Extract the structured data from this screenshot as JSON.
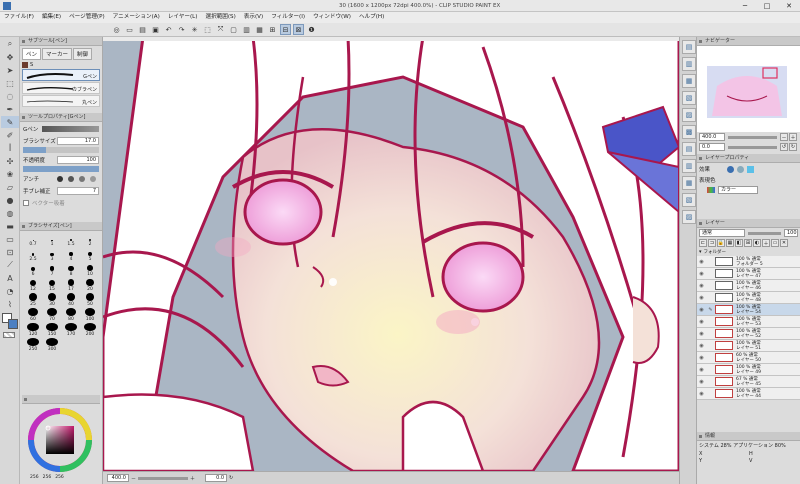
{
  "title": "30 (1600 x 1200px 72dpi 400.0%) - CLIP STUDIO PAINT EX",
  "menu": [
    "ファイル(F)",
    "編集(E)",
    "ページ管理(P)",
    "アニメーション(A)",
    "レイヤー(L)",
    "選択範囲(S)",
    "表示(V)",
    "フィルター(I)",
    "ウィンドウ(W)",
    "ヘルプ(H)"
  ],
  "left": {
    "subtool_header": "サブツール[ペン]",
    "tabs": [
      "ペン",
      "マーカー",
      "制御"
    ],
    "current_subtool": "S",
    "brushes": [
      {
        "label": "Gペン",
        "selected": true
      },
      {
        "label": "カブラペン",
        "selected": false
      },
      {
        "label": "丸ペン",
        "selected": false
      }
    ],
    "toolprop_header": "ツールプロパティ[Gペン]",
    "toolprop_name": "Gペン",
    "brush_size_label": "ブラシサイズ",
    "brush_size_value": "17.0",
    "opacity_label": "不透明度",
    "opacity_value": "100",
    "antialias_label": "アンチ",
    "stabilize_label": "手ブレ補正",
    "stabilize_value": "7",
    "vector_label": "ベクター吸着",
    "size_header": "ブラシサイズ[ペン]",
    "sizes": [
      "0.7",
      "1",
      "1.5",
      "2",
      "2.5",
      "3",
      "4",
      "5",
      "6",
      "7",
      "8",
      "10",
      "12",
      "15",
      "17",
      "20",
      "25",
      "30",
      "40",
      "50",
      "60",
      "70",
      "80",
      "100",
      "120",
      "150",
      "170",
      "200",
      "250",
      "300"
    ],
    "color_values": [
      "256",
      "256",
      "256"
    ]
  },
  "tools": [
    "zoom-icon",
    "move-icon",
    "operation-icon",
    "select-icon",
    "lasso-icon",
    "eyedropper-icon",
    "pen-icon",
    "pencil-icon",
    "brush-icon",
    "airbrush-icon",
    "deco-icon",
    "eraser-icon",
    "blend-icon",
    "fill-icon",
    "gradient-icon",
    "figure-icon",
    "frame-icon",
    "ruler-icon",
    "text-icon",
    "balloon-icon",
    "line-fix-icon"
  ],
  "status": {
    "zoom": "400.0",
    "angle": "0.0"
  },
  "right": {
    "navigator_header": "ナビゲーター",
    "nav_zoom": "400.0",
    "nav_angle": "0.0",
    "layerprop_header": "レイヤープロパティ",
    "effect_label": "効果",
    "expression_label": "表現色",
    "expression_value": "カラー",
    "layer_header": "レイヤー",
    "blend_mode": "通常",
    "opacity": "100",
    "folder_label": "フォルダー",
    "layers": [
      {
        "line1": "100 % 通常",
        "line2": "フォルダー 5",
        "selected": false,
        "folder": true
      },
      {
        "line1": "100 % 通常",
        "line2": "レイヤー 47",
        "selected": false
      },
      {
        "line1": "100 % 通常",
        "line2": "レイヤー 46",
        "selected": false
      },
      {
        "line1": "100 % 通常",
        "line2": "レイヤー 48",
        "selected": false
      },
      {
        "line1": "100 % 通常",
        "line2": "レイヤー 54",
        "selected": true
      },
      {
        "line1": "100 % 通常",
        "line2": "レイヤー 53",
        "selected": false
      },
      {
        "line1": "100 % 通常",
        "line2": "レイヤー 52",
        "selected": false
      },
      {
        "line1": "100 % 通常",
        "line2": "レイヤー 51",
        "selected": false
      },
      {
        "line1": "60 % 通常",
        "line2": "レイヤー 50",
        "selected": false
      },
      {
        "line1": "100 % 通常",
        "line2": "レイヤー 49",
        "selected": false
      },
      {
        "line1": "67 % 通常",
        "line2": "レイヤー 45",
        "selected": false
      },
      {
        "line1": "100 % 通常",
        "line2": "レイヤー 44",
        "selected": false
      }
    ],
    "info_header": "情報",
    "system_line": "システム 28%  アプリケーション 80%",
    "coord_labels": [
      "X",
      "Y",
      "H",
      "V"
    ]
  },
  "colors": {
    "accent": "#7d99bb",
    "line": "#a8174d",
    "skin": "#f4e2dc",
    "eye": "#f6c9ee",
    "bg": "#aab6c4"
  }
}
